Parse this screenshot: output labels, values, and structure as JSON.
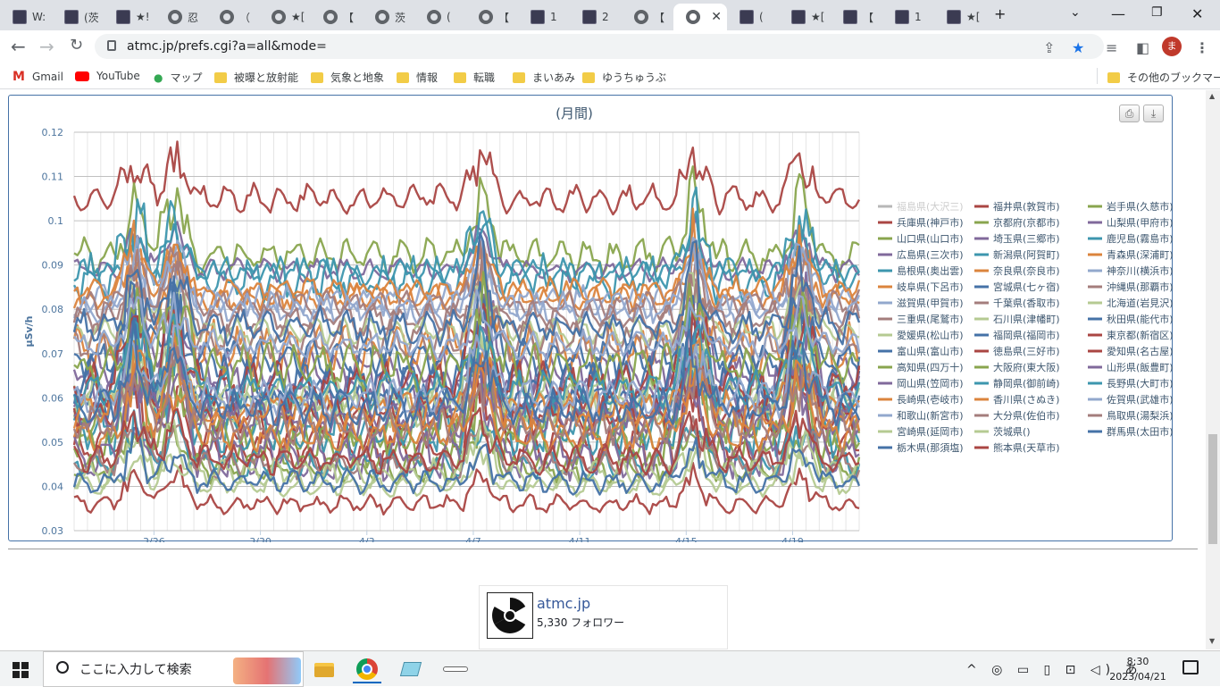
{
  "browser": {
    "tabs": [
      {
        "label": "W:",
        "icon": "dark-favicon-icon"
      },
      {
        "label": "(茨",
        "icon": "dark-favicon-icon"
      },
      {
        "label": "★!",
        "icon": "dark-favicon-icon"
      },
      {
        "label": "忍 ",
        "icon": "globe-icon"
      },
      {
        "label": "（",
        "icon": "globe-icon"
      },
      {
        "label": "★[",
        "icon": "globe-icon"
      },
      {
        "label": "【",
        "icon": "globe-icon"
      },
      {
        "label": "茨",
        "icon": "globe-icon"
      },
      {
        "label": "(",
        "icon": "globe-icon"
      },
      {
        "label": "【",
        "icon": "globe-icon"
      },
      {
        "label": "1",
        "icon": "dark-favicon-icon"
      },
      {
        "label": "2",
        "icon": "dark-favicon-icon"
      },
      {
        "label": "【",
        "icon": "globe-icon"
      },
      {
        "label": "",
        "icon": "globe-icon",
        "active": true
      },
      {
        "label": "(",
        "icon": "dark-favicon-icon"
      },
      {
        "label": "★[",
        "icon": "dark-favicon-icon"
      },
      {
        "label": "【",
        "icon": "dark-favicon-icon"
      },
      {
        "label": "1",
        "icon": "dark-favicon-icon"
      },
      {
        "label": "★[",
        "icon": "dark-favicon-icon"
      }
    ],
    "tab_close": "✕",
    "new_tab": "+",
    "url": "atmc.jp/prefs.cgi?a=all&mode=",
    "profile_initial": "ま",
    "bookmarks": [
      {
        "label": "Gmail",
        "icon": "gmail-icon"
      },
      {
        "label": "YouTube",
        "icon": "youtube-icon"
      },
      {
        "label": "マップ",
        "icon": "maps-pin-icon"
      },
      {
        "label": "被曝と放射能",
        "icon": "folder-icon"
      },
      {
        "label": "気象と地象",
        "icon": "folder-icon"
      },
      {
        "label": "情報",
        "icon": "folder-icon"
      },
      {
        "label": "転職",
        "icon": "folder-icon"
      },
      {
        "label": "まいあみ",
        "icon": "folder-icon"
      },
      {
        "label": "ゆうちゅうぶ",
        "icon": "folder-icon"
      }
    ],
    "other_bookmarks": "その他のブックマーク"
  },
  "chart_data": {
    "type": "line",
    "title": "(月間)",
    "ylabel": "μSv/h",
    "xlabel": "",
    "ylim": [
      0.03,
      0.12
    ],
    "yticks": [
      "0.03",
      "0.04",
      "0.05",
      "0.06",
      "0.07",
      "0.08",
      "0.09",
      "0.1",
      "0.11",
      "0.12"
    ],
    "x_range_days": [
      0,
      29.5
    ],
    "xticks": [
      {
        "label": "3/26",
        "day": 3
      },
      {
        "label": "3/30",
        "day": 7
      },
      {
        "label": "4/3",
        "day": 11
      },
      {
        "label": "4/7",
        "day": 15
      },
      {
        "label": "4/11",
        "day": 19
      },
      {
        "label": "4/15",
        "day": 23
      },
      {
        "label": "4/19",
        "day": 27
      }
    ],
    "grid": true,
    "legend_position": "right",
    "spike_days": [
      2.3,
      3.8,
      15.3,
      23.3,
      27.3
    ],
    "series": [
      {
        "name": "福島県(大沢三)",
        "color": "#b7b7b7",
        "base": 0.083,
        "amp": 0.005,
        "hidden": true
      },
      {
        "name": "福井県(敦賀市)",
        "color": "#aa4643",
        "base": 0.049,
        "amp": 0.008
      },
      {
        "name": "岩手県(久慈市)",
        "color": "#89a54e",
        "base": 0.054,
        "amp": 0.01
      },
      {
        "name": "兵庫県(神戸市)",
        "color": "#aa4643",
        "base": 0.105,
        "amp": 0.006
      },
      {
        "name": "京都府(京都市)",
        "color": "#89a54e",
        "base": 0.044,
        "amp": 0.006
      },
      {
        "name": "山梨県(甲府市)",
        "color": "#80699b",
        "base": 0.061,
        "amp": 0.012
      },
      {
        "name": "山口県(山口市)",
        "color": "#89a54e",
        "base": 0.092,
        "amp": 0.008
      },
      {
        "name": "埼玉県(三郷市)",
        "color": "#80699b",
        "base": 0.089,
        "amp": 0.005
      },
      {
        "name": "鹿児島(霧島市)",
        "color": "#3d96ae",
        "base": 0.053,
        "amp": 0.012
      },
      {
        "name": "広島県(三次市)",
        "color": "#80699b",
        "base": 0.066,
        "amp": 0.01
      },
      {
        "name": "新潟県(阿賀町)",
        "color": "#3d96ae",
        "base": 0.087,
        "amp": 0.01
      },
      {
        "name": "青森県(深浦町)",
        "color": "#db843d",
        "base": 0.083,
        "amp": 0.006
      },
      {
        "name": "島根県(奥出雲)",
        "color": "#3d96ae",
        "base": 0.088,
        "amp": 0.006
      },
      {
        "name": "奈良県(奈良市)",
        "color": "#db843d",
        "base": 0.071,
        "amp": 0.012
      },
      {
        "name": "神奈川(横浜市)",
        "color": "#92a8cd",
        "base": 0.082,
        "amp": 0.007
      },
      {
        "name": "岐阜県(下呂市)",
        "color": "#db843d",
        "base": 0.084,
        "amp": 0.006
      },
      {
        "name": "宮城県(七ヶ宿)",
        "color": "#4572a7",
        "base": 0.059,
        "amp": 0.008
      },
      {
        "name": "沖縄県(那覇市)",
        "color": "#a47d7c",
        "base": 0.081,
        "amp": 0.006
      },
      {
        "name": "滋賀県(甲賀市)",
        "color": "#92a8cd",
        "base": 0.08,
        "amp": 0.007
      },
      {
        "name": "千葉県(香取市)",
        "color": "#a47d7c",
        "base": 0.078,
        "amp": 0.007
      },
      {
        "name": "北海道(岩見沢)",
        "color": "#b5ca92",
        "base": 0.075,
        "amp": 0.006
      },
      {
        "name": "三重県(尾鷲市)",
        "color": "#a47d7c",
        "base": 0.073,
        "amp": 0.008
      },
      {
        "name": "石川県(津幡町)",
        "color": "#b5ca92",
        "base": 0.061,
        "amp": 0.008
      },
      {
        "name": "秋田県(能代市)",
        "color": "#4572a7",
        "base": 0.064,
        "amp": 0.01
      },
      {
        "name": "愛媛県(松山市)",
        "color": "#b5ca92",
        "base": 0.058,
        "amp": 0.008
      },
      {
        "name": "福岡県(福岡市)",
        "color": "#4572a7",
        "base": 0.076,
        "amp": 0.008
      },
      {
        "name": "東京都(新宿区)",
        "color": "#aa4643",
        "base": 0.036,
        "amp": 0.004
      },
      {
        "name": "富山県(富山市)",
        "color": "#4572a7",
        "base": 0.069,
        "amp": 0.008
      },
      {
        "name": "徳島県(三好市)",
        "color": "#aa4643",
        "base": 0.056,
        "amp": 0.008
      },
      {
        "name": "愛知県(名古屋)",
        "color": "#aa4643",
        "base": 0.063,
        "amp": 0.01
      },
      {
        "name": "高知県(四万十)",
        "color": "#89a54e",
        "base": 0.05,
        "amp": 0.01
      },
      {
        "name": "大阪府(東大阪)",
        "color": "#89a54e",
        "base": 0.067,
        "amp": 0.01
      },
      {
        "name": "山形県(飯豊町)",
        "color": "#80699b",
        "base": 0.047,
        "amp": 0.01
      },
      {
        "name": "岡山県(笠岡市)",
        "color": "#80699b",
        "base": 0.055,
        "amp": 0.008
      },
      {
        "name": "静岡県(御前崎)",
        "color": "#3d96ae",
        "base": 0.045,
        "amp": 0.006
      },
      {
        "name": "長野県(大町市)",
        "color": "#3d96ae",
        "base": 0.062,
        "amp": 0.008
      },
      {
        "name": "長崎県(壱岐市)",
        "color": "#db843d",
        "base": 0.057,
        "amp": 0.008
      },
      {
        "name": "香川県(さぬき)",
        "color": "#db843d",
        "base": 0.052,
        "amp": 0.008
      },
      {
        "name": "佐賀県(武雄市)",
        "color": "#92a8cd",
        "base": 0.072,
        "amp": 0.006
      },
      {
        "name": "和歌山(新宮市)",
        "color": "#92a8cd",
        "base": 0.06,
        "amp": 0.008
      },
      {
        "name": "大分県(佐伯市)",
        "color": "#a47d7c",
        "base": 0.045,
        "amp": 0.006
      },
      {
        "name": "鳥取県(湯梨浜)",
        "color": "#a47d7c",
        "base": 0.054,
        "amp": 0.008
      },
      {
        "name": "宮崎県(延岡市)",
        "color": "#b5ca92",
        "base": 0.043,
        "amp": 0.006
      },
      {
        "name": "茨城県()",
        "color": "#b5ca92",
        "base": 0.04,
        "amp": 0.004
      },
      {
        "name": "群馬県(太田市)",
        "color": "#4572a7",
        "base": 0.041,
        "amp": 0.005
      },
      {
        "name": "栃木県(那須塩)",
        "color": "#4572a7",
        "base": 0.058,
        "amp": 0.008
      },
      {
        "name": "熊本県(天草市)",
        "color": "#aa4643",
        "base": 0.046,
        "amp": 0.006
      }
    ]
  },
  "widget": {
    "name": "atmc.jp",
    "followers": "5,330 フォロワー"
  },
  "taskbar": {
    "search_placeholder": "ここに入力して検索",
    "tray": "^ ◎ ▭ ▯ ⊡ ◁) あ",
    "time": "8:30",
    "date": "2023/04/21"
  }
}
